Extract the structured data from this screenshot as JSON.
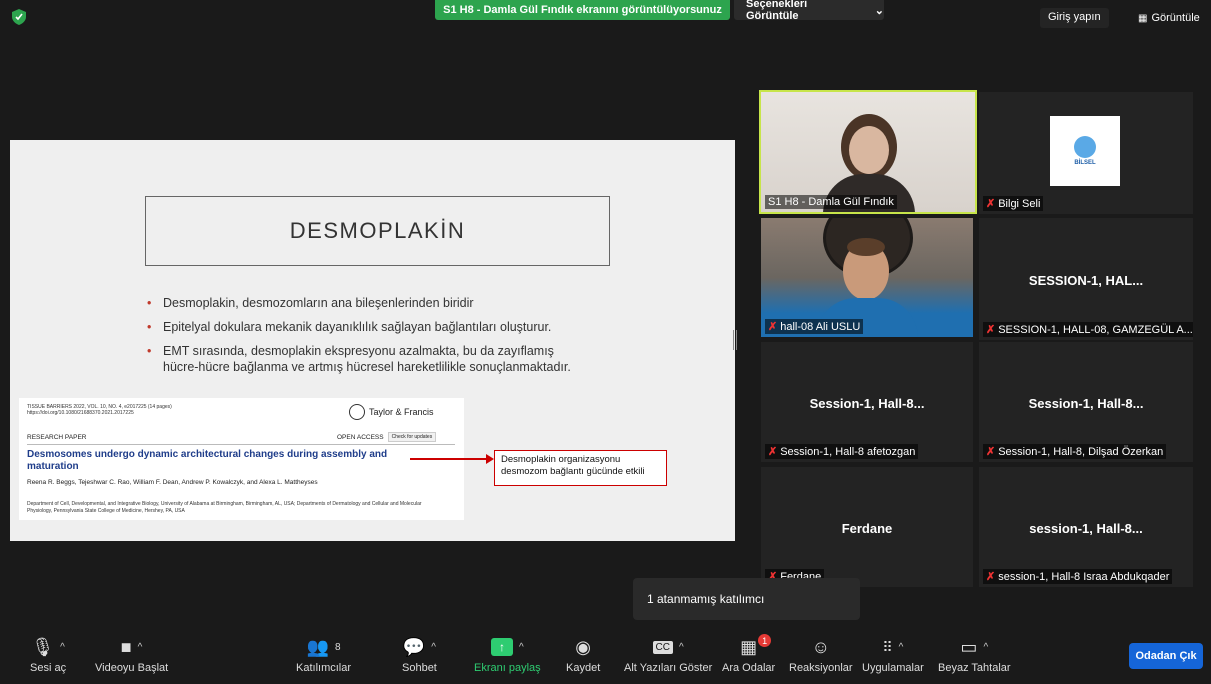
{
  "topbar": {
    "share_banner": "S1 H8 - Damla Gül Fındık ekranını görüntülüyorsunuz",
    "view_options": "Seçenekleri Görüntüle",
    "signin": "Giriş yapın",
    "view": "Görüntüle"
  },
  "slide": {
    "title": "DESMOPLAKİN",
    "bullets": [
      "Desmoplakin, desmozomların ana bileşenlerinden biridir",
      "Epitelyal dokulara mekanik dayanıklılık sağlayan bağlantıları oluşturur.",
      "EMT sırasında, desmoplakin ekspresyonu azalmakta, bu da zayıflamış hücre-hücre bağlanma ve artmış hücresel hareketlilikle sonuçlanmaktadır."
    ],
    "paper": {
      "journal": "TISSUE BARRIERS 2022, VOL. 10, NO. 4, e2017225 (14 pages) https://doi.org/10.1080/21688370.2021.2017225",
      "publisher": "Taylor & Francis",
      "publisher_sub": "Taylor & Francis Group",
      "section": "RESEARCH PAPER",
      "open_access": "OPEN ACCESS",
      "check_updates": "Check for updates",
      "title": "Desmosomes undergo dynamic architectural changes during assembly and maturation",
      "authors": "Reena R. Beggs, Tejeshwar C. Rao, William F. Dean, Andrew P. Kowalczyk, and Alexa L. Mattheyses",
      "affiliation": "Department of Cell, Developmental, and Integrative Biology, University of Alabama at Birmingham, Birmingham, AL, USA; Departments of Dermatology and Cellular and Molecular Physiology, Pennsylvania State College of Medicine, Hershey, PA, USA"
    },
    "callout": "Desmoplakin organizasyonu desmozom bağlantı gücünde etkili"
  },
  "gallery": [
    {
      "label": "S1 H8 - Damla Gül Fındık",
      "muted": false
    },
    {
      "label": "Bilgi Seli",
      "muted": true,
      "logo_text": "BİLSEL"
    },
    {
      "label": "hall-08 Ali USLU",
      "muted": true
    },
    {
      "center": "SESSION-1,  HAL...",
      "label": "SESSION-1, HALL-08, GAMZEGÜL A...",
      "muted": true
    },
    {
      "center": "Session-1,  Hall-8...",
      "label": "Session-1, Hall-8 afetozgan",
      "muted": true
    },
    {
      "center": "Session-1,  Hall-8...",
      "label": "Session-1, Hall-8, Dilşad Özerkan",
      "muted": true
    },
    {
      "center": "Ferdane",
      "label": "Ferdane",
      "muted": true
    },
    {
      "center": "session-1,  Hall-8...",
      "label": "session-1, Hall-8 Israa Abdukqader",
      "muted": true
    }
  ],
  "tooltip": "1 atanmamış katılımcı",
  "toolbar": {
    "audio": "Sesi aç",
    "video": "Videoyu Başlat",
    "participants": "Katılımcılar",
    "participants_count": "8",
    "chat": "Sohbet",
    "share": "Ekranı paylaş",
    "record": "Kaydet",
    "captions": "Alt Yazıları Göster",
    "breakout": "Ara Odalar",
    "breakout_badge": "1",
    "reactions": "Reaksiyonlar",
    "apps": "Uygulamalar",
    "whiteboard": "Beyaz Tahtalar",
    "leave": "Odadan Çık"
  },
  "colors": {
    "accent_green": "#2da44e",
    "leave_blue": "#1565d8",
    "active_speaker": "#c7e54a",
    "muted_red": "#e33333"
  }
}
